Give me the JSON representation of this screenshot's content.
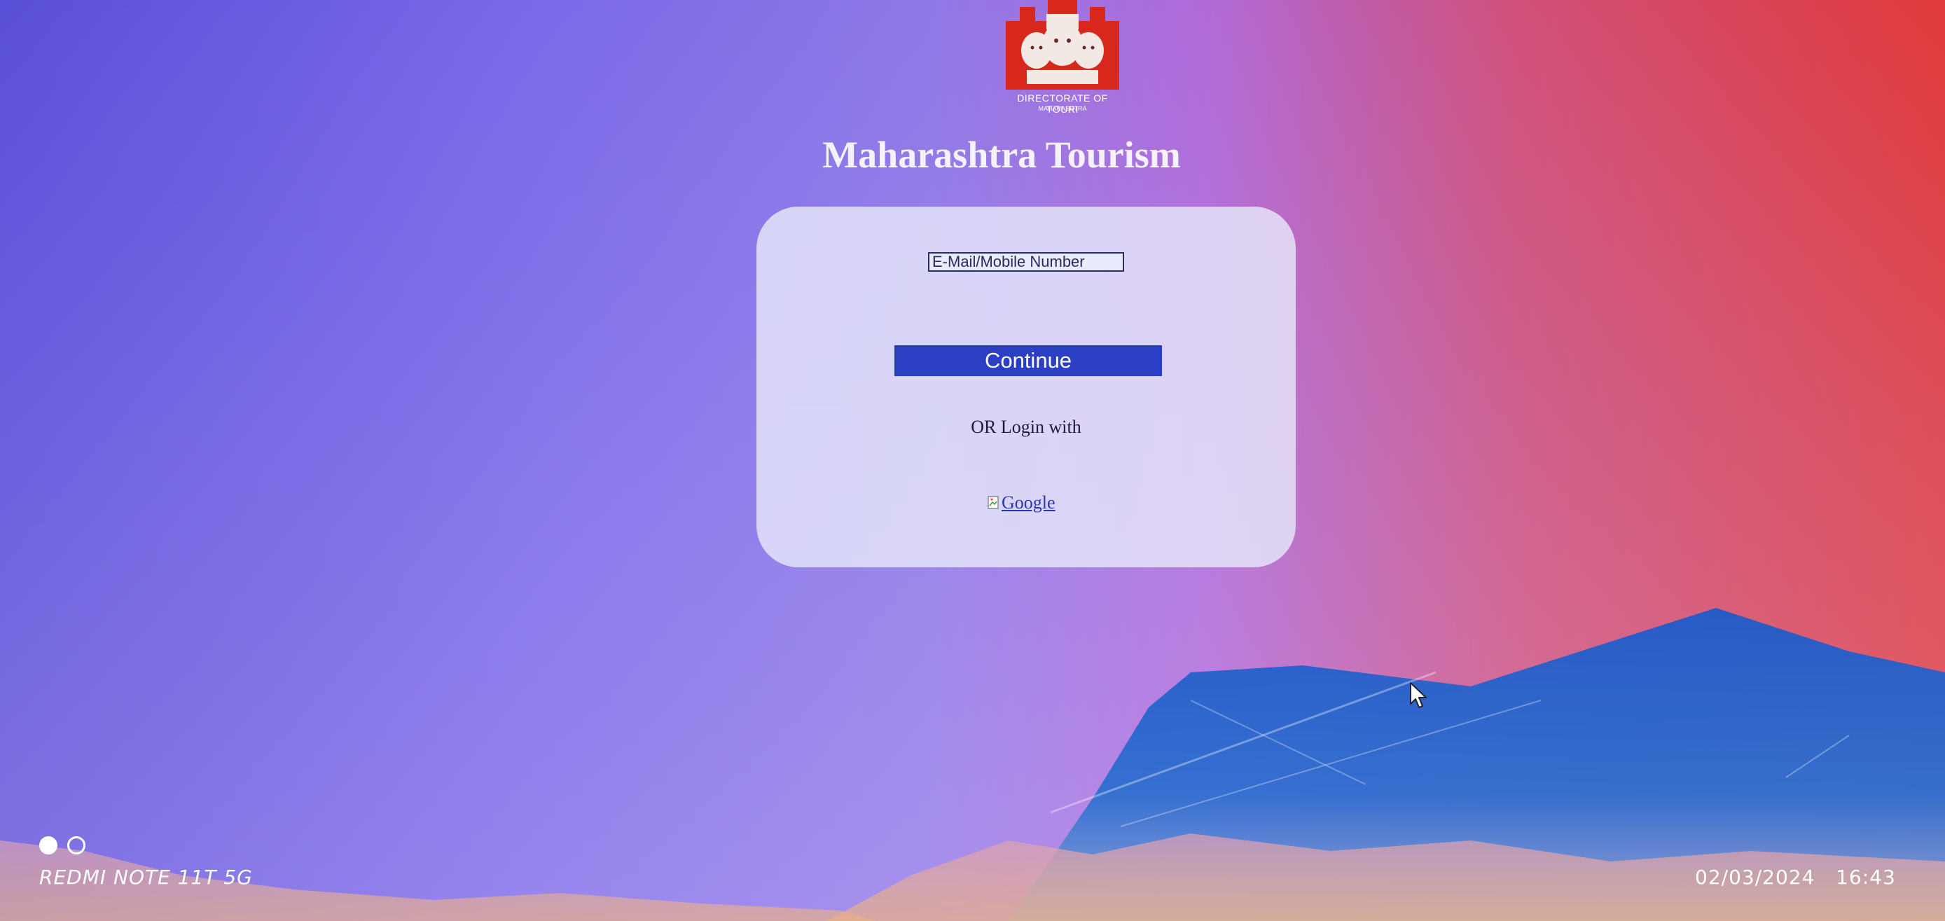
{
  "logo": {
    "text_line1": "DIRECTORATE OF TOURI",
    "text_line2": "MAHARASHTRA",
    "brand_color": "#d8271c"
  },
  "page": {
    "title": "Maharashtra Tourism"
  },
  "login": {
    "email_placeholder": "E-Mail/Mobile Number",
    "email_value": "",
    "continue_label": "Continue",
    "or_text": "OR Login with",
    "google_link_text": "Google",
    "accent_color": "#2b3fc4"
  },
  "camera_overlay": {
    "device": "REDMI NOTE 11T 5G",
    "date": "02/03/2024",
    "time": "16:43"
  }
}
